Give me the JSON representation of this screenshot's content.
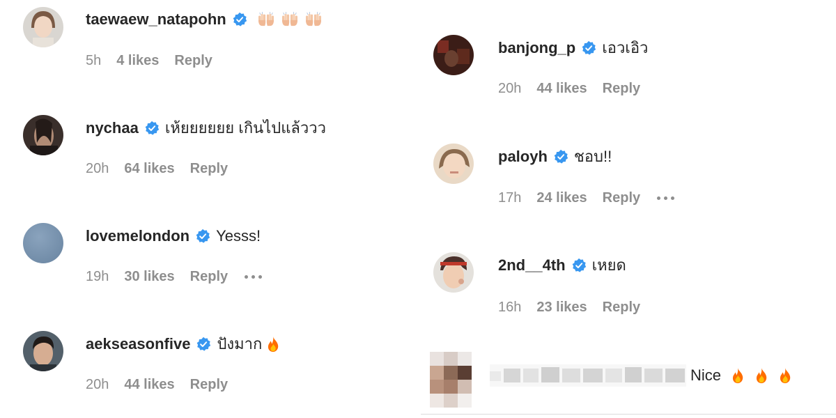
{
  "left_column": [
    {
      "username": "taewaew_natapohn",
      "text": "",
      "emoji": "raising-hands x3",
      "time": "5h",
      "likes": "4 likes",
      "reply": "Reply"
    },
    {
      "username": "nychaa",
      "text": "เห้ยยยยยย เกินไปแล้ววว",
      "time": "20h",
      "likes": "64 likes",
      "reply": "Reply"
    },
    {
      "username": "lovemelondon",
      "text": "Yesss!",
      "time": "19h",
      "likes": "30 likes",
      "reply": "Reply"
    },
    {
      "username": "aekseasonfive",
      "text": "ปังมาก",
      "emoji": "fire",
      "time": "20h",
      "likes": "44 likes",
      "reply": "Reply"
    }
  ],
  "right_column": [
    {
      "username": "banjong_p",
      "text": "เอวเอิว",
      "time": "20h",
      "likes": "44 likes",
      "reply": "Reply"
    },
    {
      "username": "paloyh",
      "text": "ชอบ!!",
      "time": "17h",
      "likes": "24 likes",
      "reply": "Reply"
    },
    {
      "username": "2nd__4th",
      "text": "เหยด",
      "time": "16h",
      "likes": "23 likes",
      "reply": "Reply"
    }
  ],
  "blurred_comment": {
    "text": "Nice",
    "emoji": "fire x3"
  },
  "colors": {
    "verified_blue": "#3897f0",
    "meta_gray": "#8e8e8e",
    "text": "#262626",
    "fire_orange": "#ff6d00"
  },
  "icons": {
    "verified": "verified-badge-icon",
    "more": "more-options-icon",
    "fire": "fire-emoji-icon",
    "hands": "raising-hands-emoji-icon"
  }
}
